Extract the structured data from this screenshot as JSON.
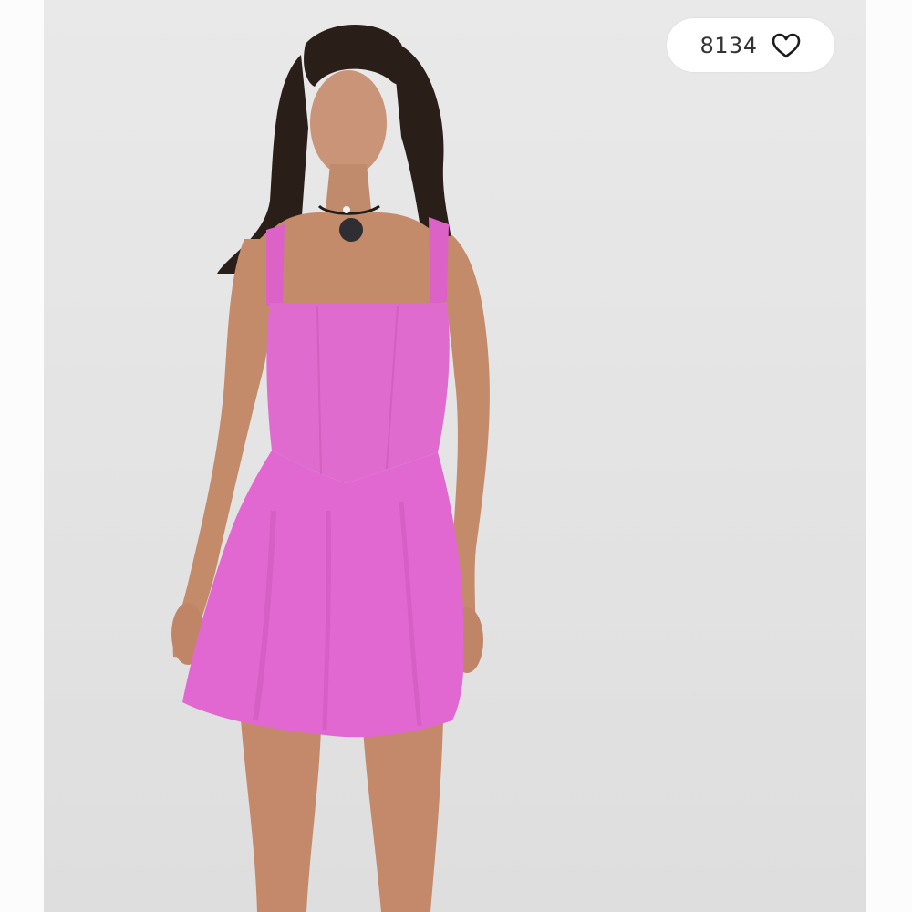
{
  "product": {
    "image": {
      "subject": "woman-in-pink-mini-dress",
      "dress_color": "#e26bd0",
      "background_color": "#e6e6e6"
    }
  },
  "likes": {
    "count": "8134",
    "icon": "heart-outline-icon"
  }
}
